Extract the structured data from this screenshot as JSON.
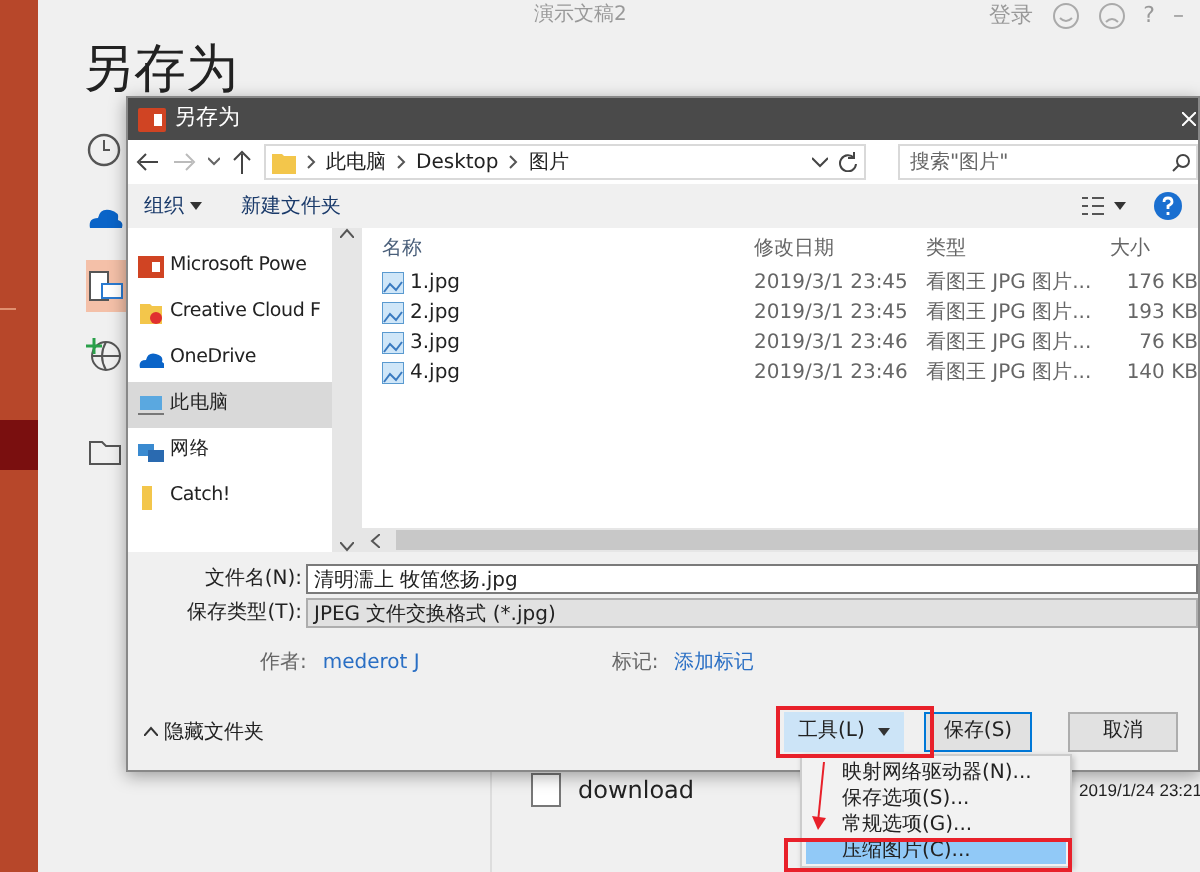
{
  "app": {
    "title": "演示文稿2",
    "sign_in": "登录",
    "help": "?",
    "minimize": "–",
    "page_title": "另存为",
    "nav_icons": [
      {
        "kind": "clock",
        "selected": false
      },
      {
        "kind": "cloud",
        "selected": false
      },
      {
        "kind": "device",
        "selected": true
      },
      {
        "kind": "globe",
        "selected": false
      },
      {
        "kind": "folder",
        "selected": false
      }
    ]
  },
  "background_list": {
    "rows": [
      {
        "name": "download",
        "date": "2019/1/24 23:21"
      }
    ]
  },
  "dialog": {
    "title": "另存为",
    "breadcrumb": [
      "此电脑",
      "Desktop",
      "图片"
    ],
    "search": {
      "placeholder": "搜索\"图片\""
    },
    "toolbar": {
      "organize": "组织",
      "new_folder": "新建文件夹"
    },
    "nav_pane": [
      {
        "label": "Microsoft Powe",
        "kind": "app",
        "selected": false
      },
      {
        "label": "Creative Cloud F",
        "kind": "cc",
        "selected": false
      },
      {
        "label": "OneDrive",
        "kind": "cloud",
        "selected": false
      },
      {
        "label": "此电脑",
        "kind": "pc",
        "selected": true
      },
      {
        "label": "网络",
        "kind": "network",
        "selected": false
      },
      {
        "label": "Catch!",
        "kind": "folder",
        "selected": false
      }
    ],
    "columns": [
      "名称",
      "修改日期",
      "类型",
      "大小"
    ],
    "rows": [
      {
        "name": "1.jpg",
        "date": "2019/3/1 23:45",
        "type": "看图王 JPG 图片...",
        "size": "176 KB"
      },
      {
        "name": "2.jpg",
        "date": "2019/3/1 23:45",
        "type": "看图王 JPG 图片...",
        "size": "193 KB"
      },
      {
        "name": "3.jpg",
        "date": "2019/3/1 23:46",
        "type": "看图王 JPG 图片...",
        "size": "76 KB"
      },
      {
        "name": "4.jpg",
        "date": "2019/3/1 23:46",
        "type": "看图王 JPG 图片...",
        "size": "140 KB"
      }
    ],
    "file_name": {
      "label": "文件名(N):",
      "value": "清明濡上 牧笛悠扬.jpg"
    },
    "file_type": {
      "label": "保存类型(T):",
      "value": "JPEG 文件交换格式 (*.jpg)"
    },
    "author": {
      "label": "作者:",
      "value": "mederot J"
    },
    "tags": {
      "label": "标记:",
      "value": "添加标记"
    },
    "hide_folders": "隐藏文件夹",
    "buttons": {
      "tools": "工具(L)",
      "save": "保存(S)",
      "cancel": "取消"
    },
    "tools_menu": [
      {
        "label": "映射网络驱动器(N)...",
        "selected": false
      },
      {
        "label": "保存选项(S)...",
        "selected": false
      },
      {
        "label": "常规选项(G)...",
        "selected": false
      },
      {
        "label": "压缩图片(C)...",
        "selected": true
      }
    ]
  }
}
